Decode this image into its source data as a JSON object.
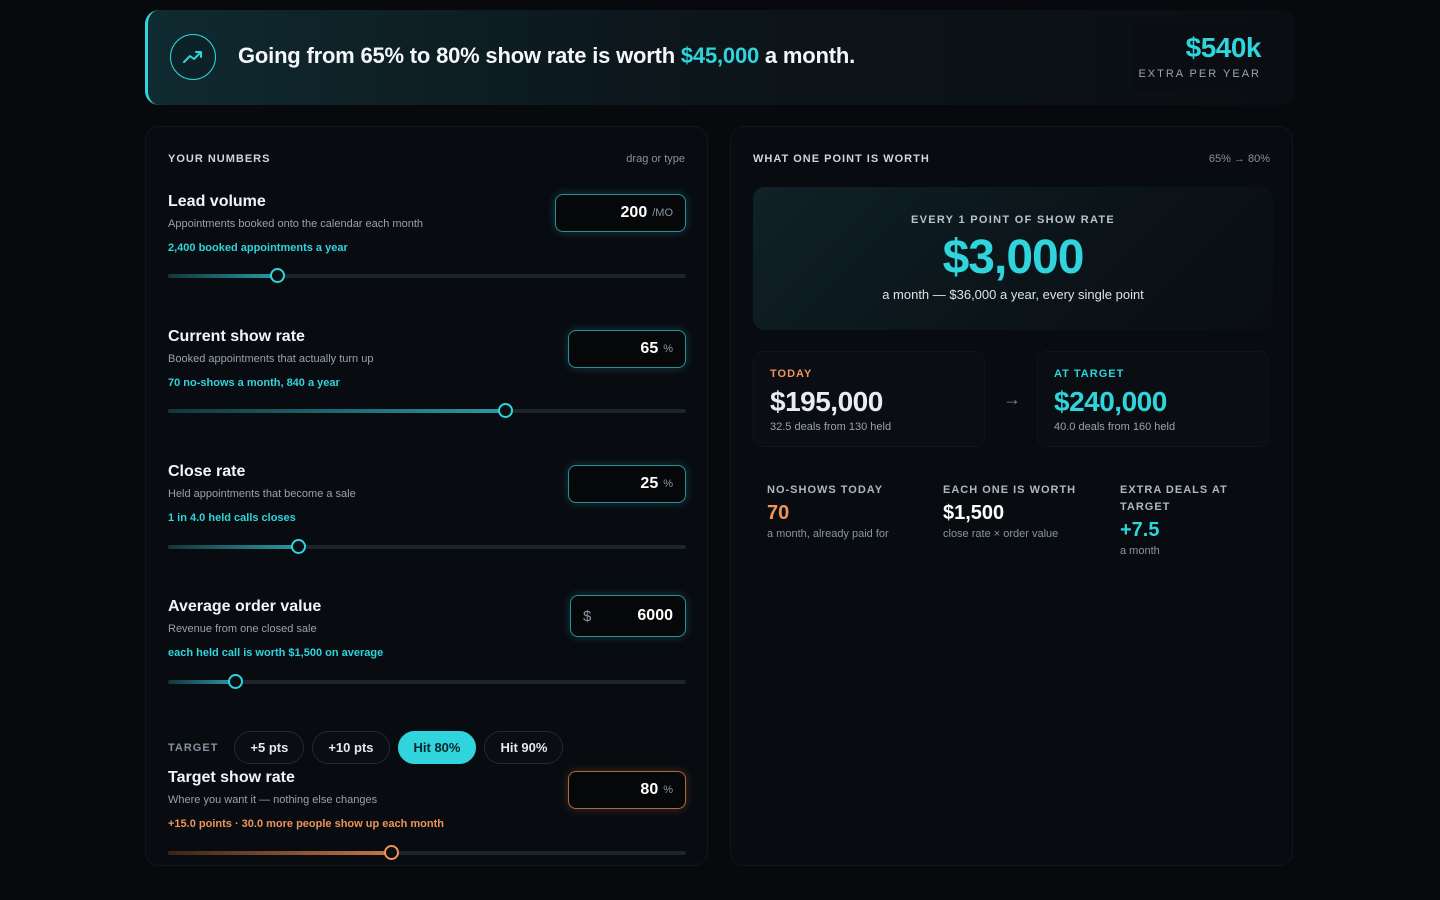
{
  "banner": {
    "prefix": "Going from 65% to 80% show rate is worth ",
    "highlight": "$45,000",
    "suffix": " a month.",
    "badge_value": "$540k",
    "badge_label": "EXTRA PER YEAR"
  },
  "inputs": {
    "title": "YOUR NUMBERS",
    "hint": "drag or type",
    "fields": [
      {
        "label": "Lead volume",
        "desc": "Appointments booked onto the calendar each month",
        "note": "2,400 booked appointments a year",
        "value": "200",
        "unit": "/MO",
        "prefix": "",
        "slider_fraction": 0.21
      },
      {
        "label": "Current show rate",
        "desc": "Booked appointments that actually turn up",
        "note": "70 no-shows a month, 840 a year",
        "value": "65",
        "unit": "%",
        "prefix": "",
        "slider_fraction": 0.65
      },
      {
        "label": "Close rate",
        "desc": "Held appointments that become a sale",
        "note": "1 in 4.0 held calls closes",
        "value": "25",
        "unit": "%",
        "prefix": "",
        "slider_fraction": 0.25
      },
      {
        "label": "Average order value",
        "desc": "Revenue from one closed sale",
        "note": "each held call is worth $1,500 on average",
        "value": "6000",
        "unit": "",
        "prefix": "$",
        "slider_fraction": 0.13
      }
    ],
    "target": {
      "label": "TARGET",
      "pills": [
        {
          "label": "+5 pts",
          "active": false
        },
        {
          "label": "+10 pts",
          "active": false
        },
        {
          "label": "Hit 80%",
          "active": true
        },
        {
          "label": "Hit 90%",
          "active": false
        }
      ],
      "field": {
        "label": "Target show rate",
        "desc": "Where you want it — nothing else changes",
        "note": "+15.0 points · 30.0 more people show up each month",
        "value": "80",
        "unit": "%",
        "slider_fraction": 0.43
      }
    }
  },
  "results": {
    "title": "WHAT ONE POINT IS WORTH",
    "range": "65% → 80%",
    "hero": {
      "label": "EVERY 1 POINT OF SHOW RATE",
      "value": "$3,000",
      "sub": "a month — $36,000 a year, every single point"
    },
    "today": {
      "label": "TODAY",
      "value": "$195,000",
      "sub": "32.5 deals from 130 held"
    },
    "arrow": "→",
    "target": {
      "label": "AT TARGET",
      "value": "$240,000",
      "sub": "40.0 deals from 160 held"
    },
    "stats": [
      {
        "label": "NO-SHOWS TODAY",
        "value": "70",
        "sub": "a month, already paid for",
        "color": "#f0935a"
      },
      {
        "label": "EACH ONE IS WORTH",
        "value": "$1,500",
        "sub": "close rate × order value",
        "color": "#ffffff"
      },
      {
        "label": "EXTRA DEALS AT TARGET",
        "value": "+7.5",
        "sub": "a month",
        "color": "#2fd4dc"
      }
    ]
  },
  "colors": {
    "accent": "#2fd4dc",
    "warning": "#f0935a",
    "background": "#07090d"
  },
  "icons": {
    "banner": "trending-up-icon"
  }
}
